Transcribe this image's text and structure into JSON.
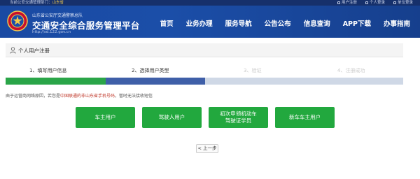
{
  "topbar": {
    "gov_site_label": "当前公安交通管理部门：",
    "province": "山东省",
    "links": [
      {
        "icon": "user-register-icon",
        "label": "用户注册"
      },
      {
        "icon": "user-login-icon",
        "label": "个人登录"
      },
      {
        "icon": "unit-login-icon",
        "label": "单位登录"
      }
    ]
  },
  "header": {
    "subtitle": "山东省公安厅交通警察总队",
    "title": "交通安全综合服务管理平台",
    "url": "http://sd.122.gov.cn",
    "nav": [
      "首页",
      "业务办理",
      "服务导航",
      "公告公布",
      "信息查询",
      "APP下载",
      "办事指南"
    ]
  },
  "page": {
    "section_title": "个人用户注册",
    "steps": [
      {
        "label": "1、填写用户信息",
        "status": "done"
      },
      {
        "label": "2、选择用户类型",
        "status": "current"
      },
      {
        "label": "3、验证",
        "status": "pending"
      },
      {
        "label": "4、注册成功",
        "status": "pending"
      }
    ],
    "notice_prefix": "由于运营商网络原因，若您是",
    "notice_highlight": "中国联通的非山东省手机号码",
    "notice_suffix": "，暂时无法接收短信",
    "user_types": [
      {
        "line1": "车主用户",
        "line2": ""
      },
      {
        "line1": "驾驶人用户",
        "line2": ""
      },
      {
        "line1": "初次申领机动车",
        "line2": "驾驶证学员"
      },
      {
        "line1": "新车车主用户",
        "line2": ""
      }
    ],
    "back_label": "< 上一步"
  },
  "colors": {
    "header_blue": "#1a4aa3",
    "topbar_navy": "#16306b",
    "step_done": "#2aa548",
    "step_current": "#3f5fa8",
    "step_pending": "#cfd8e6",
    "button_green": "#22a83e",
    "notice_red": "#c0392b"
  }
}
